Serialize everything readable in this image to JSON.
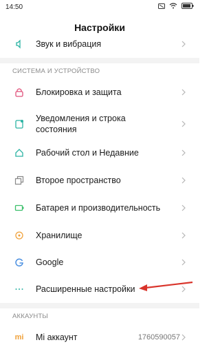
{
  "status_bar": {
    "time": "14:50"
  },
  "header": {
    "title": "Настройки"
  },
  "top_item": {
    "label": "Звук и вибрация"
  },
  "section_system": {
    "title": "СИСТЕМА И УСТРОЙСТВО"
  },
  "system_items": [
    {
      "label": "Блокировка и защита",
      "icon": "lock-icon"
    },
    {
      "label": "Уведомления и строка состояния",
      "icon": "notifications-icon"
    },
    {
      "label": "Рабочий стол и Недавние",
      "icon": "home-icon"
    },
    {
      "label": "Второе пространство",
      "icon": "second-space-icon"
    },
    {
      "label": "Батарея и производительность",
      "icon": "battery-icon"
    },
    {
      "label": "Хранилище",
      "icon": "storage-icon"
    },
    {
      "label": "Google",
      "icon": "google-icon"
    },
    {
      "label": "Расширенные настройки",
      "icon": "more-icon"
    }
  ],
  "section_accounts": {
    "title": "АККАУНТЫ"
  },
  "account_item": {
    "label": "Mi аккаунт",
    "icon_text": "mi",
    "value": "1760590057"
  },
  "colors": {
    "accent_red": "#d9342b",
    "icon_teal": "#2bb3a3",
    "icon_orange": "#f0a13a",
    "icon_pink": "#e0507a",
    "icon_blue": "#4a8fe0",
    "icon_green": "#3bbf6a"
  }
}
